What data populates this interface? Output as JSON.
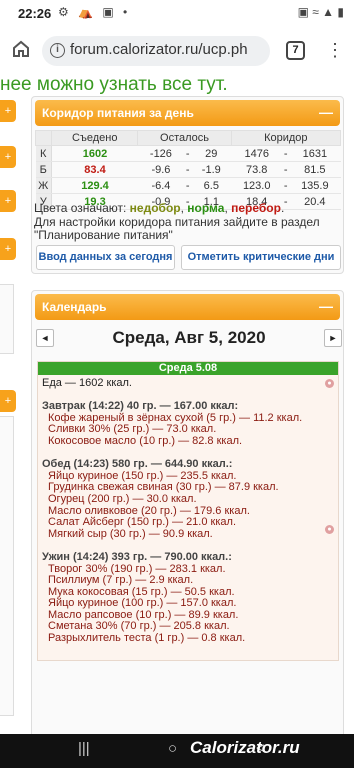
{
  "status_bar": {
    "time": "22:26",
    "left_icons": "⚙ ⛺ ▣ •",
    "right_icons": "▣ ≈ ▲ ▮"
  },
  "browser": {
    "url": "forum.calorizator.ru/ucp.ph",
    "tab_count": "7",
    "info_icon": "i",
    "home_icon": "home-icon",
    "menu_icon": "⋮"
  },
  "headline": "нее можно узнать все тут.",
  "corridor": {
    "title": "Коридор питания за день",
    "minimize": "—",
    "columns": [
      "Съедено",
      "Осталось",
      "Коридор"
    ],
    "rows": [
      {
        "k": "К",
        "eaten": "1602",
        "rem_a": "-126",
        "sep1": "-",
        "rem_b": "29",
        "cor_a": "1476",
        "sep2": "-",
        "cor_b": "1631",
        "color": "green"
      },
      {
        "k": "Б",
        "eaten": "83.4",
        "rem_a": "-9.6",
        "sep1": "-",
        "rem_b": "-1.9",
        "cor_a": "73.8",
        "sep2": "-",
        "cor_b": "81.5",
        "color": "red"
      },
      {
        "k": "Ж",
        "eaten": "129.4",
        "rem_a": "-6.4",
        "sep1": "-",
        "rem_b": "6.5",
        "cor_a": "123.0",
        "sep2": "-",
        "cor_b": "135.9",
        "color": "green"
      },
      {
        "k": "У",
        "eaten": "19.3",
        "rem_a": "-0.9",
        "sep1": "-",
        "rem_b": "1.1",
        "cor_a": "18.4",
        "sep2": "-",
        "cor_b": "20.4",
        "color": "green"
      }
    ],
    "legend_prefix": "Цвета означают: ",
    "legend_under": "недобор",
    "legend_norm": "норма",
    "legend_over": "перебор",
    "comma": ", ",
    "dot": ".",
    "hint": "Для настройки коридора питания зайдите в раздел \"Планирование питания\"",
    "btn_enter": "Ввод данных за сегодня",
    "btn_critical": "Отметить критические дни"
  },
  "calendar": {
    "title": "Календарь",
    "minimize": "—",
    "prev": "◄",
    "next": "►",
    "date": "Среда, Авг 5, 2020",
    "day_header": "Среда 5.08",
    "food_total": "Еда — 1602 ккал.",
    "meals": [
      {
        "title": "Завтрак (14:22) 40 гр. — 167.00 ккал:",
        "items": [
          "Кофе жареный в зёрнах сухой (5 гр.) — 11.2 ккал.",
          "Сливки 30% (25 гр.) — 73.0 ккал.",
          "Кокосовое масло (10 гр.) — 82.8 ккал."
        ]
      },
      {
        "title": "Обед (14:23) 580 гр. — 644.90 ккал.:",
        "items": [
          "Яйцо куриное (150 гр.) — 235.5 ккал.",
          "Грудинка свежая свиная (30 гр.) — 87.9 ккал.",
          "Огурец (200 гр.) — 30.0 ккал.",
          "Масло оливковое (20 гр.) — 179.6 ккал.",
          "Салат Айсберг (150 гр.) — 21.0 ккал.",
          "Мягкий сыр (30 гр.) — 90.9 ккал."
        ]
      },
      {
        "title": "Ужин (14:24) 393 гр. — 790.00 ккал.:",
        "items": [
          "Творог 30% (190 гр.) — 283.1 ккал.",
          "Псиллиум (7 гр.) — 2.9 ккал.",
          "Мука кокосовая (15 гр.) — 50.5 ккал.",
          "Яйцо куриное (100 гр.) — 157.0 ккал.",
          "Масло рапсовое (10 гр.) — 89.9 ккал.",
          "Сметана 30% (70 гр.) — 205.8 ккал.",
          "Разрыхлитель теста (1 гр.) — 0.8 ккал."
        ]
      }
    ]
  },
  "navbar": {
    "recent": "|||",
    "home": "○",
    "back": "<",
    "brand": "Calorizator.ru"
  }
}
